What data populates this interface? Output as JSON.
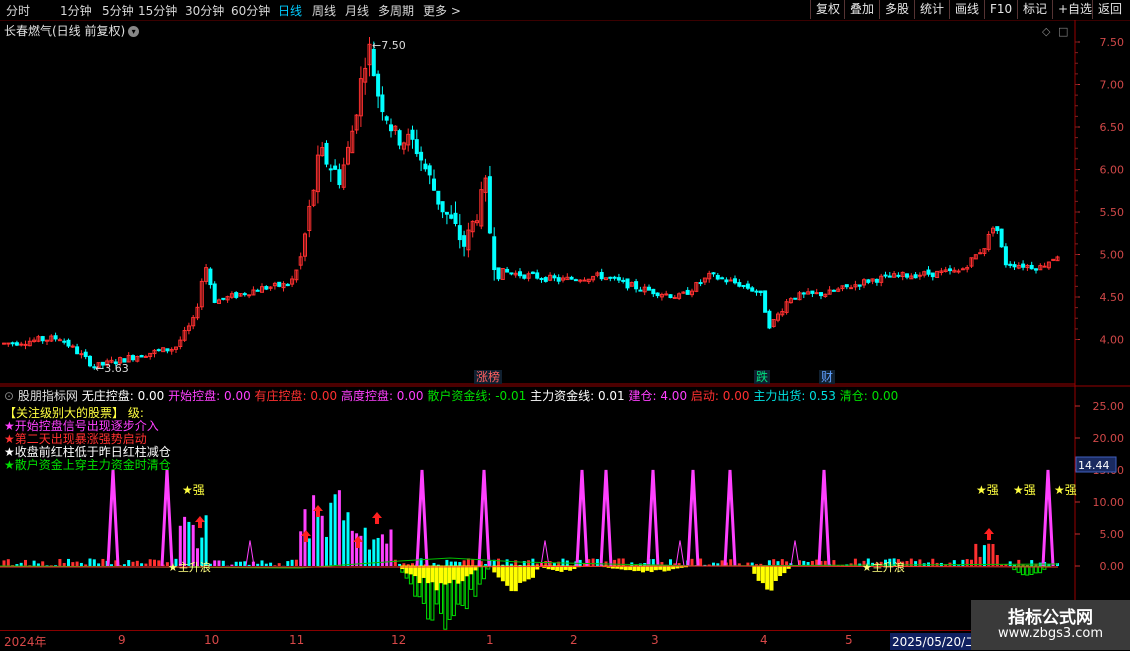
{
  "toolbar": {
    "periods": [
      "分时",
      "1分钟",
      "5分钟",
      "15分钟",
      "30分钟",
      "60分钟",
      "日线",
      "周线",
      "月线",
      "多周期",
      "更多 >"
    ],
    "active_index": 6,
    "right_buttons": [
      "复权",
      "叠加",
      "多股",
      "统计",
      "画线",
      "F10",
      "标记",
      "+自选",
      "返回"
    ]
  },
  "main_chart": {
    "title": "长春燃气(日线 前复权)",
    "high_label": "7.50",
    "low_label": "3.63",
    "y_ticks": [
      "7.50",
      "7.00",
      "6.50",
      "6.00",
      "5.50",
      "5.00",
      "4.50",
      "4.00"
    ],
    "markers": [
      {
        "text": "涨榜",
        "color": "#ff6060"
      },
      {
        "text": "跌",
        "color": "#00e080"
      },
      {
        "text": "财",
        "color": "#60a0ff"
      }
    ]
  },
  "indicator": {
    "name": "股朋指标网",
    "values": [
      {
        "label": "无庄控盘:",
        "value": "0.00",
        "color": "#ffffff"
      },
      {
        "label": "开始控盘:",
        "value": "0.00",
        "color": "#ff40ff"
      },
      {
        "label": "有庄控盘:",
        "value": "0.00",
        "color": "#ff3030"
      },
      {
        "label": "高度控盘:",
        "value": "0.00",
        "color": "#ff40ff"
      },
      {
        "label": "散户资金线:",
        "value": "-0.01",
        "color": "#00e000"
      },
      {
        "label": "主力资金线:",
        "value": "0.01",
        "color": "#ffffff"
      },
      {
        "label": "建仓:",
        "value": "4.00",
        "color": "#ff40ff"
      },
      {
        "label": "启动:",
        "value": "0.00",
        "color": "#ff3030"
      },
      {
        "label": "主力出货:",
        "value": "0.53",
        "color": "#00e0e0"
      },
      {
        "label": "清仓:",
        "value": "0.00",
        "color": "#00e000"
      }
    ],
    "legend": [
      {
        "text": "【关注级别大的股票】    级:",
        "color": "#ffff40"
      },
      {
        "text": "★开始控盘信号出现逐步介入",
        "color": "#ff40ff"
      },
      {
        "text": "★第二天出现暴涨强势启动",
        "color": "#ff3030"
      },
      {
        "text": "★收盘前红柱低于昨日红柱减仓",
        "color": "#ffffff"
      },
      {
        "text": "★散户资金上穿主力资金时清仓",
        "color": "#00e000"
      }
    ],
    "y_ticks": [
      "25.00",
      "20.00",
      "15.00",
      "10.00",
      "5.00",
      "0.00"
    ],
    "current_value": "14.44",
    "strong_label": "★强",
    "rise_label": "主升浪"
  },
  "date_axis": {
    "labels": [
      "2024年",
      "9",
      "10",
      "11",
      "12",
      "1",
      "2",
      "3",
      "4",
      "5"
    ],
    "current": "2025/05/20/二"
  },
  "watermark": {
    "title": "指标公式网",
    "url": "www.zbgs3.com"
  },
  "colors": {
    "up": "#ff3030",
    "down": "#00ffff",
    "grid": "#800000",
    "pink": "#ff40ff",
    "yellow": "#ffff00",
    "green": "#00e000"
  }
}
